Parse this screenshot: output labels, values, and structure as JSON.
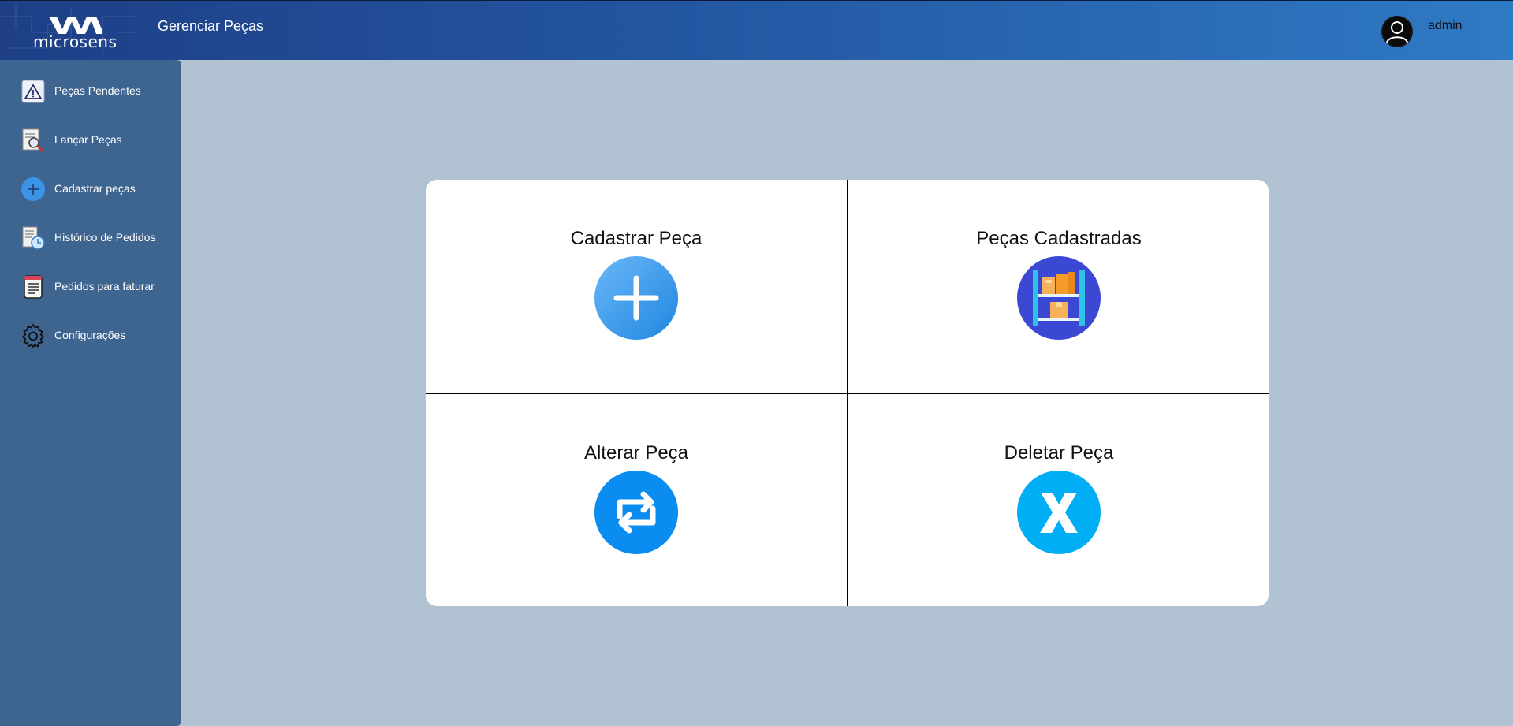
{
  "header": {
    "logo_text": "microsens",
    "page_title": "Gerenciar Peças",
    "user_name": "admin"
  },
  "sidebar": {
    "items": [
      {
        "label": "Peças Pendentes",
        "icon": "warning-icon"
      },
      {
        "label": "Lançar Peças",
        "icon": "search-document-icon"
      },
      {
        "label": "Cadastrar peças",
        "icon": "plus-circle-icon"
      },
      {
        "label": "Histórico de Pedidos",
        "icon": "history-document-icon"
      },
      {
        "label": "Pedidos para faturar",
        "icon": "invoice-icon"
      },
      {
        "label": "Configurações",
        "icon": "gear-icon"
      }
    ]
  },
  "main": {
    "tiles": [
      {
        "label": "Cadastrar Peça",
        "icon": "plus-icon",
        "color": "#2b8fe3"
      },
      {
        "label": "Peças Cadastradas",
        "icon": "shelf-icon",
        "color": "#3d4fd6"
      },
      {
        "label": "Alterar Peça",
        "icon": "swap-arrows-icon",
        "color": "#0a8cf0"
      },
      {
        "label": "Deletar Peça",
        "icon": "x-icon",
        "color": "#00aef6"
      }
    ]
  }
}
